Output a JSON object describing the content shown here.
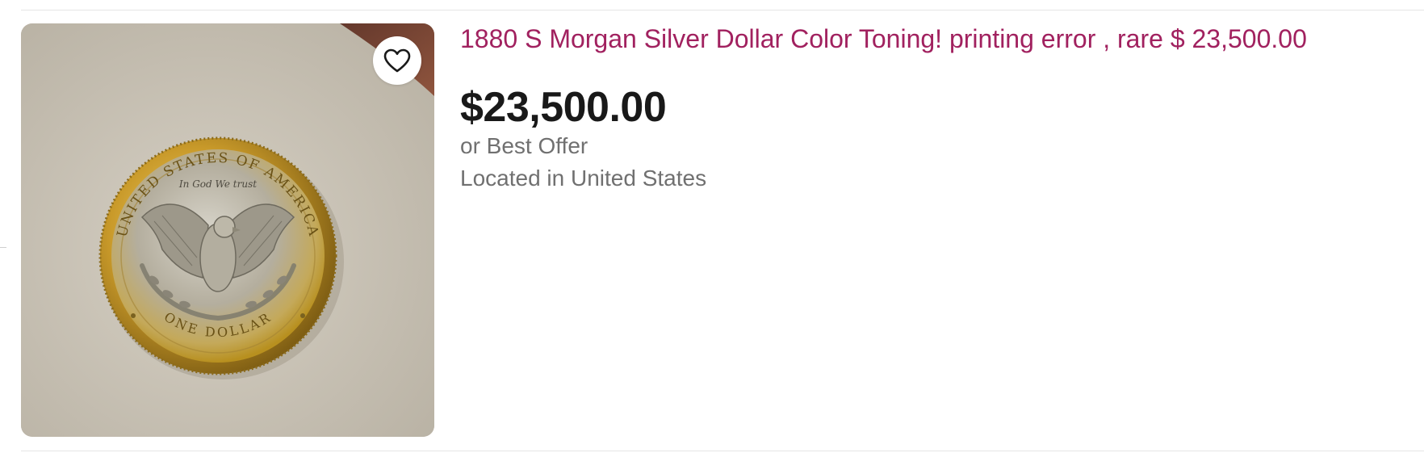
{
  "listing": {
    "title": "1880 S Morgan Silver Dollar Color Toning! printing error , rare $ 23,500.00",
    "price": "$23,500.00",
    "purchase_option": "or Best Offer",
    "location": "Located in United States",
    "image": {
      "subject": "Morgan silver dollar reverse, eagle design with gold toning",
      "coin_inscriptions": {
        "top": "UNITED STATES OF AMERICA",
        "motto": "In God We trust",
        "bottom": "ONE DOLLAR"
      }
    },
    "watch_icon": "heart-outline-icon"
  },
  "colors": {
    "title_link": "#a1215f",
    "price": "#191919",
    "secondary_text": "#707070",
    "divider": "#e5e5e5"
  }
}
